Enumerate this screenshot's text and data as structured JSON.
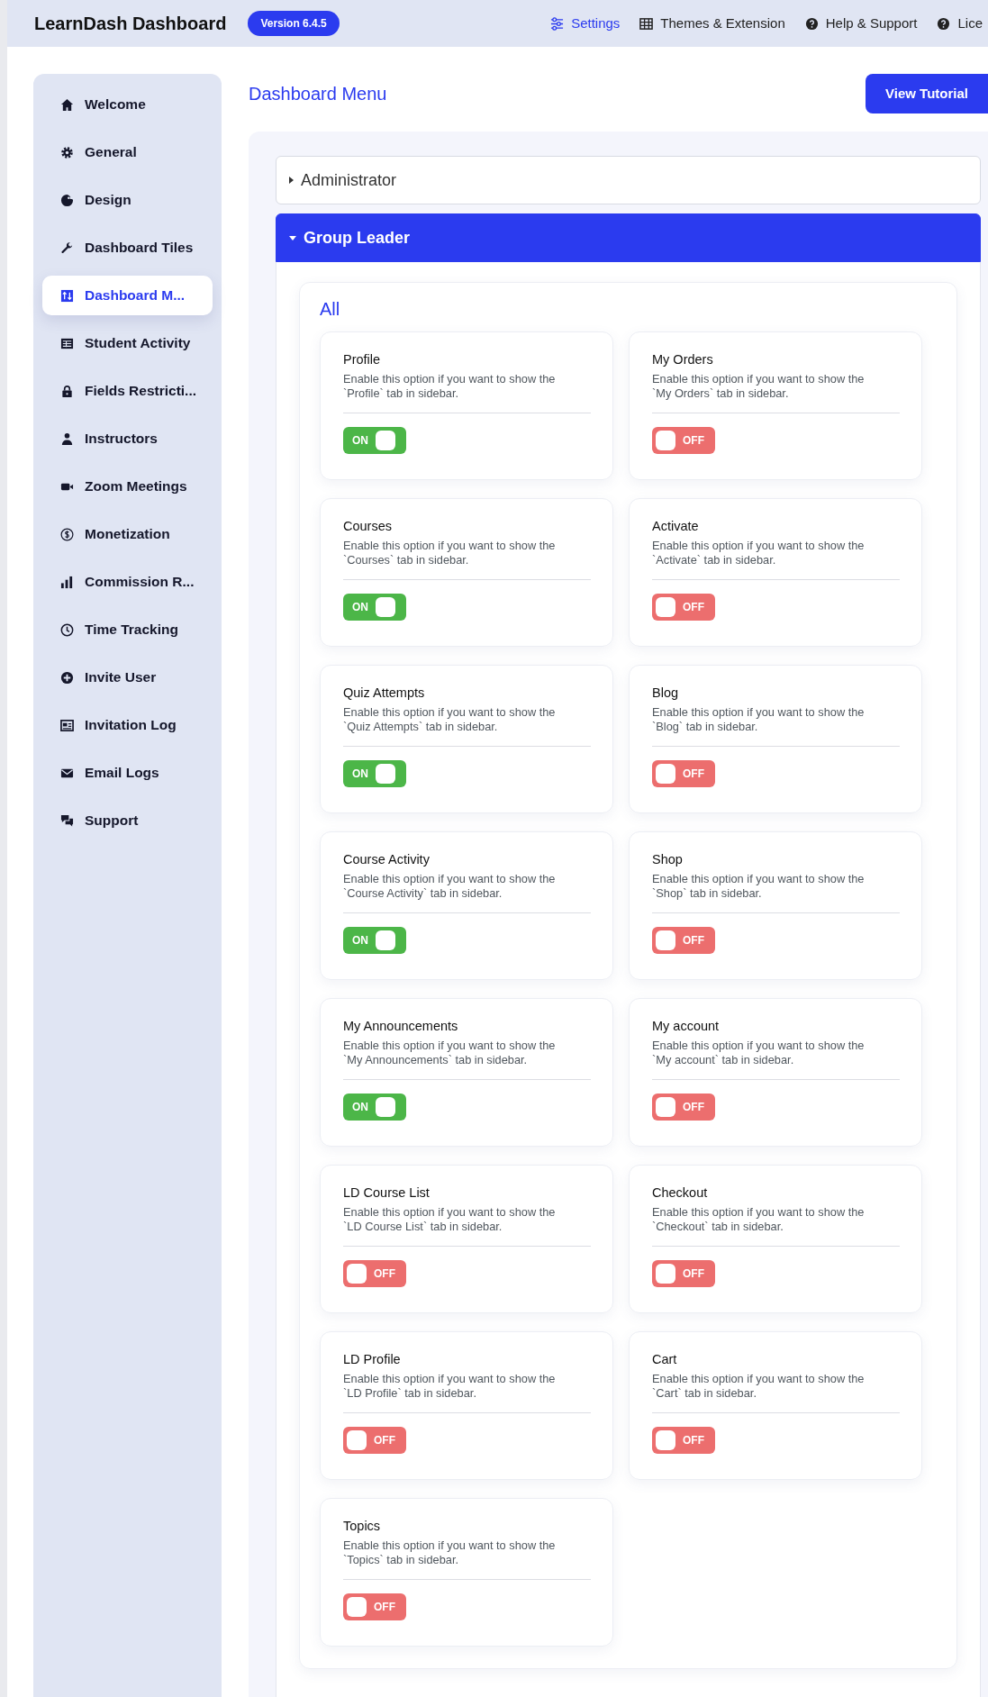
{
  "header": {
    "title": "LearnDash Dashboard",
    "version": "Version 6.4.5",
    "nav": [
      {
        "label": "Settings",
        "selected": true
      },
      {
        "label": "Themes & Extension",
        "selected": false
      },
      {
        "label": "Help & Support",
        "selected": false
      },
      {
        "label": "Lice",
        "selected": false
      }
    ]
  },
  "sidebar": {
    "items": [
      {
        "label": "Welcome",
        "selected": false
      },
      {
        "label": "General",
        "selected": false
      },
      {
        "label": "Design",
        "selected": false
      },
      {
        "label": "Dashboard Tiles",
        "selected": false
      },
      {
        "label": "Dashboard M...",
        "selected": true
      },
      {
        "label": "Student Activity",
        "selected": false
      },
      {
        "label": "Fields Restricti...",
        "selected": false
      },
      {
        "label": "Instructors",
        "selected": false
      },
      {
        "label": "Zoom Meetings",
        "selected": false
      },
      {
        "label": "Monetization",
        "selected": false
      },
      {
        "label": "Commission R...",
        "selected": false
      },
      {
        "label": "Time Tracking",
        "selected": false
      },
      {
        "label": "Invite User",
        "selected": false
      },
      {
        "label": "Invitation Log",
        "selected": false
      },
      {
        "label": "Email Logs",
        "selected": false
      },
      {
        "label": "Support",
        "selected": false
      }
    ]
  },
  "main": {
    "title": "Dashboard Menu",
    "tutorial_button": "View Tutorial"
  },
  "accordion": [
    {
      "title": "Administrator",
      "expanded": false
    },
    {
      "title": "Group Leader",
      "expanded": true,
      "section_title": "All",
      "options": [
        {
          "title": "Profile",
          "description": "Enable this option if you want to show the `Profile` tab in sidebar.",
          "on": true,
          "toggle_text": "ON"
        },
        {
          "title": "My Orders",
          "description": "Enable this option if you want to show the `My Orders` tab in sidebar.",
          "on": false,
          "toggle_text": "OFF"
        },
        {
          "title": "Courses",
          "description": "Enable this option if you want to show the `Courses` tab in sidebar.",
          "on": true,
          "toggle_text": "ON"
        },
        {
          "title": "Activate",
          "description": "Enable this option if you want to show the `Activate` tab in sidebar.",
          "on": false,
          "toggle_text": "OFF"
        },
        {
          "title": "Quiz Attempts",
          "description": "Enable this option if you want to show the `Quiz Attempts` tab in sidebar.",
          "on": true,
          "toggle_text": "ON"
        },
        {
          "title": "Blog",
          "description": "Enable this option if you want to show the `Blog` tab in sidebar.",
          "on": false,
          "toggle_text": "OFF"
        },
        {
          "title": "Course Activity",
          "description": "Enable this option if you want to show the `Course Activity` tab in sidebar.",
          "on": true,
          "toggle_text": "ON"
        },
        {
          "title": "Shop",
          "description": "Enable this option if you want to show the `Shop` tab in sidebar.",
          "on": false,
          "toggle_text": "OFF"
        },
        {
          "title": "My Announcements",
          "description": "Enable this option if you want to show the `My Announcements` tab in sidebar.",
          "on": true,
          "toggle_text": "ON"
        },
        {
          "title": "My account",
          "description": "Enable this option if you want to show the `My account` tab in sidebar.",
          "on": false,
          "toggle_text": "OFF"
        },
        {
          "title": "LD Course List",
          "description": "Enable this option if you want to show the `LD Course List` tab in sidebar.",
          "on": false,
          "toggle_text": "OFF"
        },
        {
          "title": "Checkout",
          "description": "Enable this option if you want to show the `Checkout` tab in sidebar.",
          "on": false,
          "toggle_text": "OFF"
        },
        {
          "title": "LD Profile",
          "description": "Enable this option if you want to show the `LD Profile` tab in sidebar.",
          "on": false,
          "toggle_text": "OFF"
        },
        {
          "title": "Cart",
          "description": "Enable this option if you want to show the `Cart` tab in sidebar.",
          "on": false,
          "toggle_text": "OFF"
        },
        {
          "title": "Topics",
          "description": "Enable this option if you want to show the `Topics` tab in sidebar.",
          "on": false,
          "toggle_text": "OFF"
        }
      ]
    }
  ]
}
